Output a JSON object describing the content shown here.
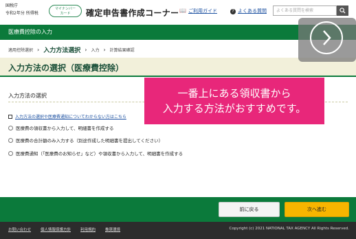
{
  "header": {
    "agency": "国税庁",
    "year_label": "令和2年分",
    "version_label": "所得税",
    "mynumber_badge_line1": "マイナンバー",
    "mynumber_badge_line2": "カード",
    "app_title": "確定申告書作成コーナー",
    "guide_link": "ご利用ガイド",
    "faq_link": "よくある質問",
    "search_placeholder": "よくある質問を検索",
    "icons": {
      "guide": "book-icon",
      "faq": "question-icon",
      "search": "search-icon"
    }
  },
  "section": {
    "title": "医療費控除の入力"
  },
  "breadcrumb": {
    "steps": [
      "適用控除選択",
      "入力方法選択",
      "入力",
      "計算結果確認"
    ],
    "current_index": 1
  },
  "page": {
    "title": "入力方法の選択（医療費控除）"
  },
  "main": {
    "subheading": "入力方法の選択",
    "help_link": "入力方法の選択や医療費通知についてわからない方はこちら",
    "options": [
      {
        "label": "医療費の領収書から入力して、明細書を作成する",
        "selected": false
      },
      {
        "label": "医療費の合計額のみ入力する（別途作成した明細書を提出してください）",
        "selected": false
      },
      {
        "label": "医療費通知（「医療費のお知らせ」など）や領収書から入力して、明細書を作成する",
        "selected": false
      }
    ]
  },
  "overlay": {
    "callout_line1": "一番上にある領収書から",
    "callout_line2": "入力する方法がおすすめです。",
    "next_arrow_icon": "chevron-right-icon"
  },
  "actions": {
    "back_label": "前に戻る",
    "next_label": "次へ進む"
  },
  "footer": {
    "links": [
      "お問い合わせ",
      "個人情報保護方針",
      "利用規約",
      "推奨環境"
    ],
    "copyright": "Copyright (c) 2021 NATIONAL TAX AGENCY All Rights Reserved."
  },
  "colors": {
    "brand_green": "#0b7a3b",
    "heading_band": "#f2f0da",
    "callout": "#e8277a",
    "next_button": "#f7b500",
    "footer": "#2c2c2c"
  }
}
